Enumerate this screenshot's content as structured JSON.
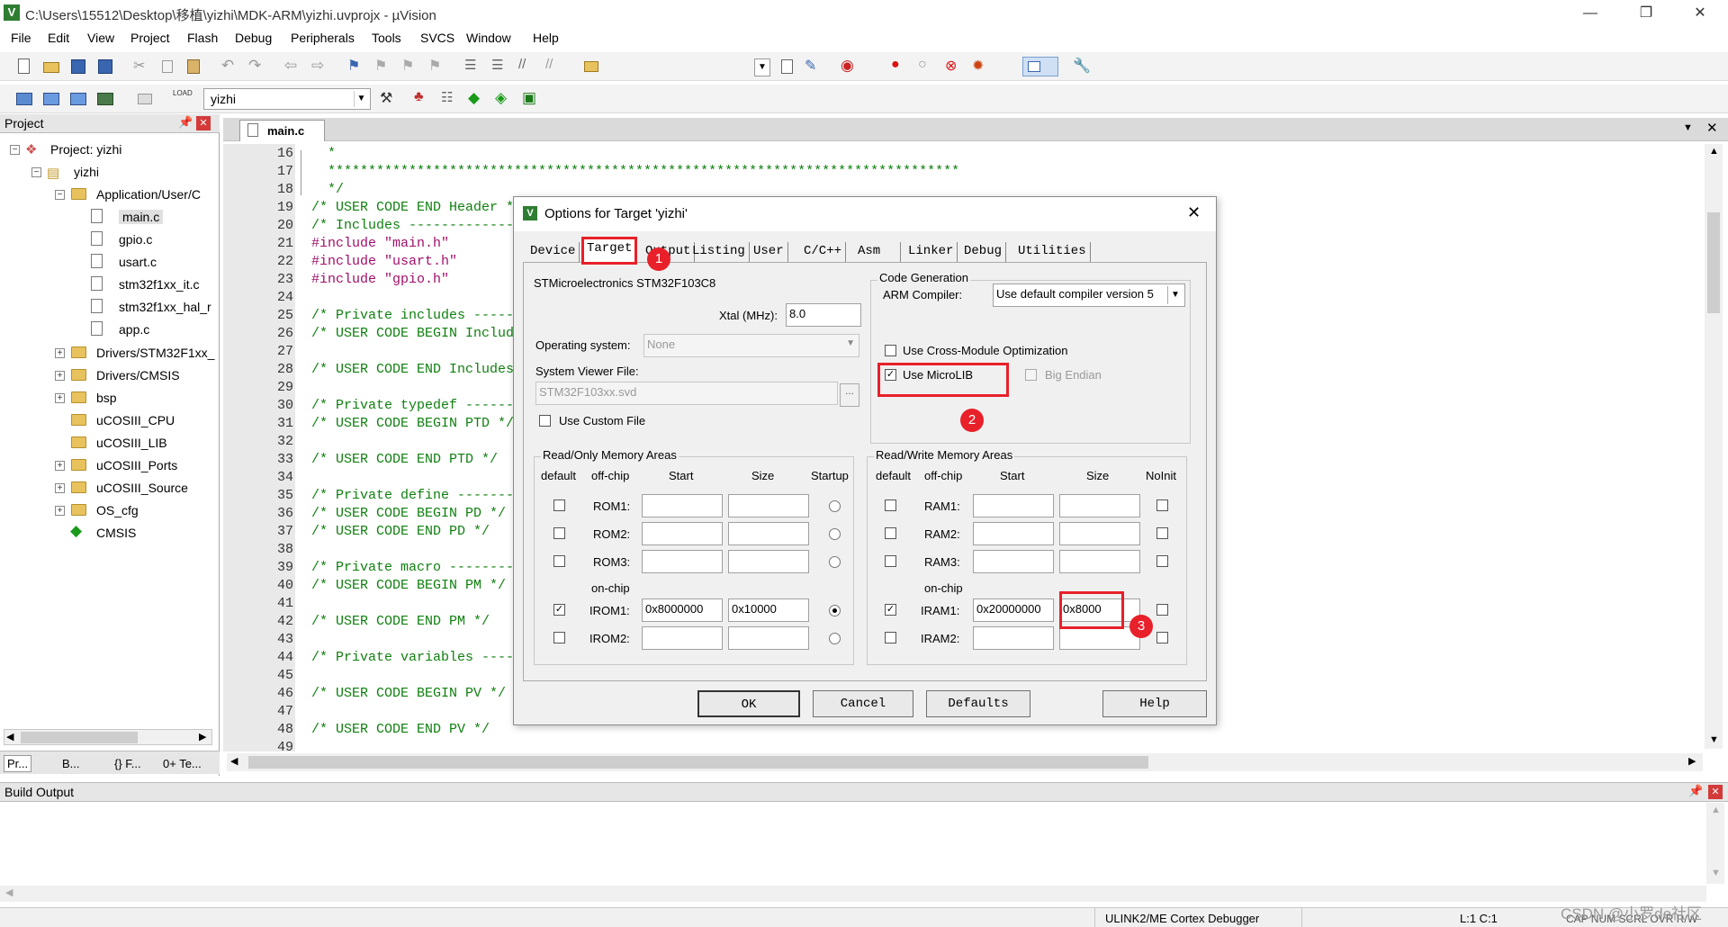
{
  "window": {
    "title": "C:\\Users\\15512\\Desktop\\移植\\yizhi\\MDK-ARM\\yizhi.uvprojx - µVision",
    "min": "—",
    "max": "❐",
    "close": "✕"
  },
  "menu": [
    "File",
    "Edit",
    "View",
    "Project",
    "Flash",
    "Debug",
    "Peripherals",
    "Tools",
    "SVCS",
    "Window",
    "Help"
  ],
  "toolbar2": {
    "target_name": "yizhi"
  },
  "project_panel": {
    "header": "Project",
    "root": "Project: yizhi",
    "target": "yizhi",
    "groups": [
      {
        "name": "Application/User/C",
        "files": [
          "main.c",
          "gpio.c",
          "usart.c",
          "stm32f1xx_it.c",
          "stm32f1xx_hal_r",
          "app.c"
        ]
      },
      {
        "name": "Drivers/STM32F1xx_"
      },
      {
        "name": "Drivers/CMSIS"
      },
      {
        "name": "bsp"
      },
      {
        "name": "uCOSIII_CPU"
      },
      {
        "name": "uCOSIII_LIB"
      },
      {
        "name": "uCOSIII_Ports"
      },
      {
        "name": "uCOSIII_Source"
      },
      {
        "name": "OS_cfg"
      },
      {
        "name": "CMSIS"
      }
    ],
    "tabs": [
      "Pr...",
      "B...",
      "{} F...",
      "0+ Te..."
    ]
  },
  "editor": {
    "tab": "main.c",
    "lines": [
      {
        "n": "16",
        "t": "  *"
      },
      {
        "n": "17",
        "t": "  ******************************************************************************"
      },
      {
        "n": "18",
        "t": "  */"
      },
      {
        "n": "19",
        "t": "/* USER CODE END Header */"
      },
      {
        "n": "20",
        "t": "/* Includes ------------------------------------------------------------------*/"
      },
      {
        "n": "21",
        "t": "#include \"main.h\""
      },
      {
        "n": "22",
        "t": "#include \"usart.h\""
      },
      {
        "n": "23",
        "t": "#include \"gpio.h\""
      },
      {
        "n": "24",
        "t": ""
      },
      {
        "n": "25",
        "t": "/* Private includes ----------------------------------------------------------*/"
      },
      {
        "n": "26",
        "t": "/* USER CODE BEGIN Includes */"
      },
      {
        "n": "27",
        "t": ""
      },
      {
        "n": "28",
        "t": "/* USER CODE END Includes */"
      },
      {
        "n": "29",
        "t": ""
      },
      {
        "n": "30",
        "t": "/* Private typedef -----------------------------------------------------------*/"
      },
      {
        "n": "31",
        "t": "/* USER CODE BEGIN PTD */"
      },
      {
        "n": "32",
        "t": ""
      },
      {
        "n": "33",
        "t": "/* USER CODE END PTD */"
      },
      {
        "n": "34",
        "t": ""
      },
      {
        "n": "35",
        "t": "/* Private define ------------------------------------------------------------*/"
      },
      {
        "n": "36",
        "t": "/* USER CODE BEGIN PD */"
      },
      {
        "n": "37",
        "t": "/* USER CODE END PD */"
      },
      {
        "n": "38",
        "t": ""
      },
      {
        "n": "39",
        "t": "/* Private macro -------------------------------------------------------------*/"
      },
      {
        "n": "40",
        "t": "/* USER CODE BEGIN PM */"
      },
      {
        "n": "41",
        "t": ""
      },
      {
        "n": "42",
        "t": "/* USER CODE END PM */"
      },
      {
        "n": "43",
        "t": ""
      },
      {
        "n": "44",
        "t": "/* Private variables ---------------------------------------------------------*/"
      },
      {
        "n": "45",
        "t": ""
      },
      {
        "n": "46",
        "t": "/* USER CODE BEGIN PV */"
      },
      {
        "n": "47",
        "t": ""
      },
      {
        "n": "48",
        "t": "/* USER CODE END PV */"
      },
      {
        "n": "49",
        "t": ""
      }
    ]
  },
  "dialog": {
    "title": "Options for Target 'yizhi'",
    "tabs": [
      "Device",
      "Target",
      "Output",
      "Listing",
      "User",
      "C/C++",
      "Asm",
      "Linker",
      "Debug",
      "Utilities"
    ],
    "device": "STMicroelectronics STM32F103C8",
    "xtal_label": "Xtal (MHz):",
    "xtal_value": "8.0",
    "os_label": "Operating system:",
    "os_value": "None",
    "svd_label": "System Viewer File:",
    "svd_value": "STM32F103xx.svd",
    "svd_browse": "...",
    "use_custom_file": "Use Custom File",
    "codegen_title": "Code Generation",
    "compiler_label": "ARM Compiler:",
    "compiler_value": "Use default compiler version 5",
    "cross_module": "Use Cross-Module Optimization",
    "microlib": "Use MicroLIB",
    "big_endian": "Big Endian",
    "ro_title": "Read/Only Memory Areas",
    "rw_title": "Read/Write Memory Areas",
    "col_default": "default",
    "col_offchip": "off-chip",
    "col_start": "Start",
    "col_size": "Size",
    "col_startup": "Startup",
    "col_noinit": "NoInit",
    "onchip": "on-chip",
    "rom": [
      {
        "name": "ROM1:",
        "start": "",
        "size": ""
      },
      {
        "name": "ROM2:",
        "start": "",
        "size": ""
      },
      {
        "name": "ROM3:",
        "start": "",
        "size": ""
      },
      {
        "name": "IROM1:",
        "start": "0x8000000",
        "size": "0x10000"
      },
      {
        "name": "IROM2:",
        "start": "",
        "size": ""
      }
    ],
    "ram": [
      {
        "name": "RAM1:",
        "start": "",
        "size": ""
      },
      {
        "name": "RAM2:",
        "start": "",
        "size": ""
      },
      {
        "name": "RAM3:",
        "start": "",
        "size": ""
      },
      {
        "name": "IRAM1:",
        "start": "0x20000000",
        "size": "0x8000"
      },
      {
        "name": "IRAM2:",
        "start": "",
        "size": ""
      }
    ],
    "buttons": {
      "ok": "OK",
      "cancel": "Cancel",
      "defaults": "Defaults",
      "help": "Help"
    },
    "annotations": [
      "1",
      "2",
      "3"
    ],
    "annotation_color": "#e8202a"
  },
  "build_output": {
    "header": "Build Output"
  },
  "status": {
    "debugger": "ULINK2/ME Cortex Debugger",
    "position": "L:1 C:1",
    "indicators": "CAP  NUM  SCRL  OVR  R/W",
    "watermark": "CSDN @小罗de社区"
  }
}
